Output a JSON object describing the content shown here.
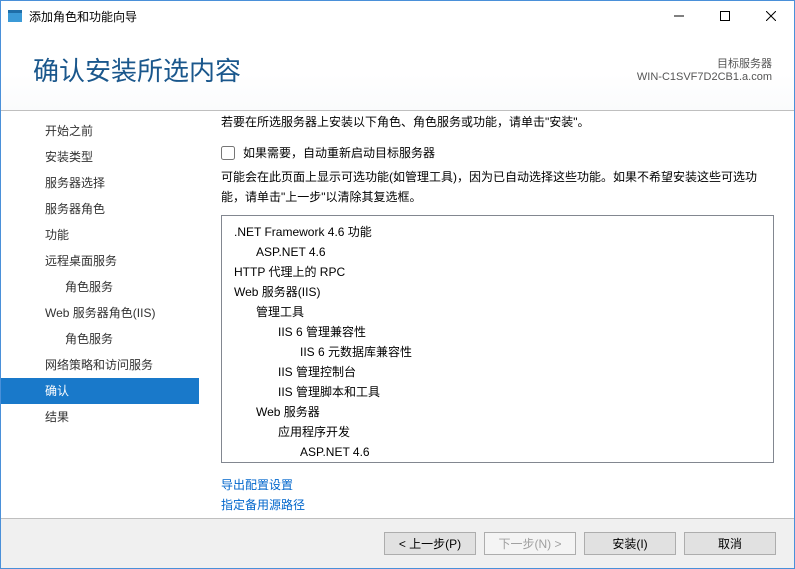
{
  "window_title": "添加角色和功能向导",
  "header": {
    "title": "确认安装所选内容",
    "target_label": "目标服务器",
    "target_value": "WIN-C1SVF7D2CB1.a.com"
  },
  "sidebar": {
    "items": [
      {
        "label": "开始之前",
        "indent": false,
        "active": false
      },
      {
        "label": "安装类型",
        "indent": false,
        "active": false
      },
      {
        "label": "服务器选择",
        "indent": false,
        "active": false
      },
      {
        "label": "服务器角色",
        "indent": false,
        "active": false
      },
      {
        "label": "功能",
        "indent": false,
        "active": false
      },
      {
        "label": "远程桌面服务",
        "indent": false,
        "active": false
      },
      {
        "label": "角色服务",
        "indent": true,
        "active": false
      },
      {
        "label": "Web 服务器角色(IIS)",
        "indent": false,
        "active": false
      },
      {
        "label": "角色服务",
        "indent": true,
        "active": false
      },
      {
        "label": "网络策略和访问服务",
        "indent": false,
        "active": false
      },
      {
        "label": "确认",
        "indent": false,
        "active": true
      },
      {
        "label": "结果",
        "indent": false,
        "active": false
      }
    ]
  },
  "content": {
    "intro": "若要在所选服务器上安装以下角色、角色服务或功能，请单击\"安装\"。",
    "restart_label": "如果需要，自动重新启动目标服务器",
    "notice": "可能会在此页面上显示可选功能(如管理工具)，因为已自动选择这些功能。如果不希望安装这些可选功能，请单击\"上一步\"以清除其复选框。",
    "tree": [
      {
        "level": 0,
        "text": ".NET Framework 4.6 功能"
      },
      {
        "level": 1,
        "text": "ASP.NET 4.6"
      },
      {
        "level": 0,
        "text": "HTTP 代理上的 RPC"
      },
      {
        "level": 0,
        "text": "Web 服务器(IIS)"
      },
      {
        "level": 1,
        "text": "管理工具"
      },
      {
        "level": 2,
        "text": "IIS 6 管理兼容性"
      },
      {
        "level": 3,
        "text": "IIS 6 元数据库兼容性"
      },
      {
        "level": 2,
        "text": "IIS 管理控制台"
      },
      {
        "level": 2,
        "text": "IIS 管理脚本和工具"
      },
      {
        "level": 1,
        "text": "Web 服务器"
      },
      {
        "level": 2,
        "text": "应用程序开发"
      },
      {
        "level": 3,
        "text": "ASP.NET 4.6"
      }
    ],
    "link_export": "导出配置设置",
    "link_altpath": "指定备用源路径"
  },
  "footer": {
    "prev": "< 上一步(P)",
    "next": "下一步(N) >",
    "install": "安装(I)",
    "cancel": "取消"
  }
}
